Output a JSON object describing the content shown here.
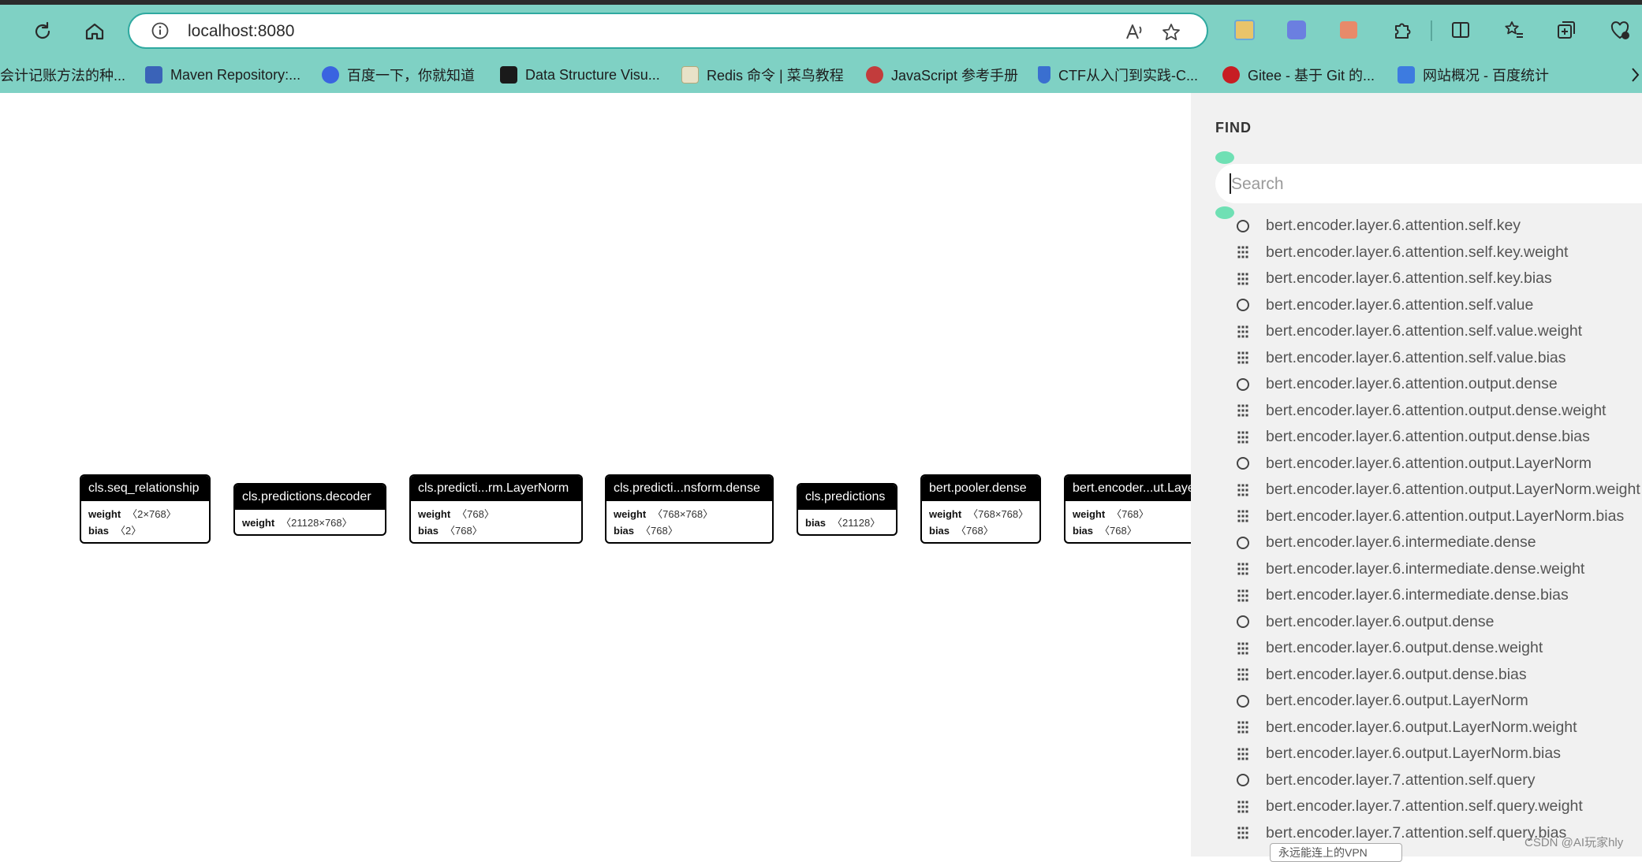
{
  "browser": {
    "url": "localhost:8080",
    "bookmarks": [
      {
        "label": "会计记账方法的种...",
        "color": ""
      },
      {
        "label": "Maven Repository:...",
        "color": "#3a63b8"
      },
      {
        "label": "百度一下，你就知道",
        "color": "#3a64e0"
      },
      {
        "label": "Data Structure Visu...",
        "color": "#1a1a1a"
      },
      {
        "label": "Redis 命令 | 菜鸟教程",
        "color": "#e8e2c8"
      },
      {
        "label": "JavaScript 参考手册",
        "color": "#c23c3c"
      },
      {
        "label": "CTF从入门到实践-C...",
        "color": "#3a6fd0"
      },
      {
        "label": "Gitee - 基于 Git 的...",
        "color": "#c71d23"
      },
      {
        "label": "网站概况 - 百度统计",
        "color": "#3d7be0"
      }
    ]
  },
  "graph": {
    "nodes": [
      {
        "title": "cls.seq_relationship",
        "rows": [
          {
            "name": "weight",
            "shape": "〈2×768〉"
          },
          {
            "name": "bias",
            "shape": "〈2〉"
          }
        ]
      },
      {
        "title": "cls.predictions.decoder",
        "rows": [
          {
            "name": "weight",
            "shape": "〈21128×768〉"
          }
        ]
      },
      {
        "title": "cls.predicti...rm.LayerNorm",
        "rows": [
          {
            "name": "weight",
            "shape": "〈768〉"
          },
          {
            "name": "bias",
            "shape": "〈768〉"
          }
        ]
      },
      {
        "title": "cls.predicti...nsform.dense",
        "rows": [
          {
            "name": "weight",
            "shape": "〈768×768〉"
          },
          {
            "name": "bias",
            "shape": "〈768〉"
          }
        ]
      },
      {
        "title": "cls.predictions",
        "rows": [
          {
            "name": "bias",
            "shape": "〈21128〉"
          }
        ]
      },
      {
        "title": "bert.pooler.dense",
        "rows": [
          {
            "name": "weight",
            "shape": "〈768×768〉"
          },
          {
            "name": "bias",
            "shape": "〈768〉"
          }
        ]
      },
      {
        "title": "bert.encoder...ut.LayerNorm",
        "rows": [
          {
            "name": "weight",
            "shape": "〈768〉"
          },
          {
            "name": "bias",
            "shape": "〈768〉"
          }
        ]
      }
    ]
  },
  "find": {
    "title": "FIND",
    "placeholder": "Search",
    "results": [
      {
        "icon": "node-circle-icon",
        "label": "bert.encoder.layer.6.attention.self.key"
      },
      {
        "icon": "tensor-grid-icon",
        "label": "bert.encoder.layer.6.attention.self.key.weight"
      },
      {
        "icon": "tensor-grid-icon",
        "label": "bert.encoder.layer.6.attention.self.key.bias"
      },
      {
        "icon": "node-circle-icon",
        "label": "bert.encoder.layer.6.attention.self.value"
      },
      {
        "icon": "tensor-grid-icon",
        "label": "bert.encoder.layer.6.attention.self.value.weight"
      },
      {
        "icon": "tensor-grid-icon",
        "label": "bert.encoder.layer.6.attention.self.value.bias"
      },
      {
        "icon": "node-circle-icon",
        "label": "bert.encoder.layer.6.attention.output.dense"
      },
      {
        "icon": "tensor-grid-icon",
        "label": "bert.encoder.layer.6.attention.output.dense.weight"
      },
      {
        "icon": "tensor-grid-icon",
        "label": "bert.encoder.layer.6.attention.output.dense.bias"
      },
      {
        "icon": "node-circle-icon",
        "label": "bert.encoder.layer.6.attention.output.LayerNorm"
      },
      {
        "icon": "tensor-grid-icon",
        "label": "bert.encoder.layer.6.attention.output.LayerNorm.weight"
      },
      {
        "icon": "tensor-grid-icon",
        "label": "bert.encoder.layer.6.attention.output.LayerNorm.bias"
      },
      {
        "icon": "node-circle-icon",
        "label": "bert.encoder.layer.6.intermediate.dense"
      },
      {
        "icon": "tensor-grid-icon",
        "label": "bert.encoder.layer.6.intermediate.dense.weight"
      },
      {
        "icon": "tensor-grid-icon",
        "label": "bert.encoder.layer.6.intermediate.dense.bias"
      },
      {
        "icon": "node-circle-icon",
        "label": "bert.encoder.layer.6.output.dense"
      },
      {
        "icon": "tensor-grid-icon",
        "label": "bert.encoder.layer.6.output.dense.weight"
      },
      {
        "icon": "tensor-grid-icon",
        "label": "bert.encoder.layer.6.output.dense.bias"
      },
      {
        "icon": "node-circle-icon",
        "label": "bert.encoder.layer.6.output.LayerNorm"
      },
      {
        "icon": "tensor-grid-icon",
        "label": "bert.encoder.layer.6.output.LayerNorm.weight"
      },
      {
        "icon": "tensor-grid-icon",
        "label": "bert.encoder.layer.6.output.LayerNorm.bias"
      },
      {
        "icon": "node-circle-icon",
        "label": "bert.encoder.layer.7.attention.self.query"
      },
      {
        "icon": "tensor-grid-icon",
        "label": "bert.encoder.layer.7.attention.self.query.weight"
      },
      {
        "icon": "tensor-grid-icon",
        "label": "bert.encoder.layer.7.attention.self.query.bias"
      }
    ]
  },
  "overlay": {
    "watermark": "CSDN @AI玩家hly",
    "popup_text": "永远能连上的VPN"
  }
}
